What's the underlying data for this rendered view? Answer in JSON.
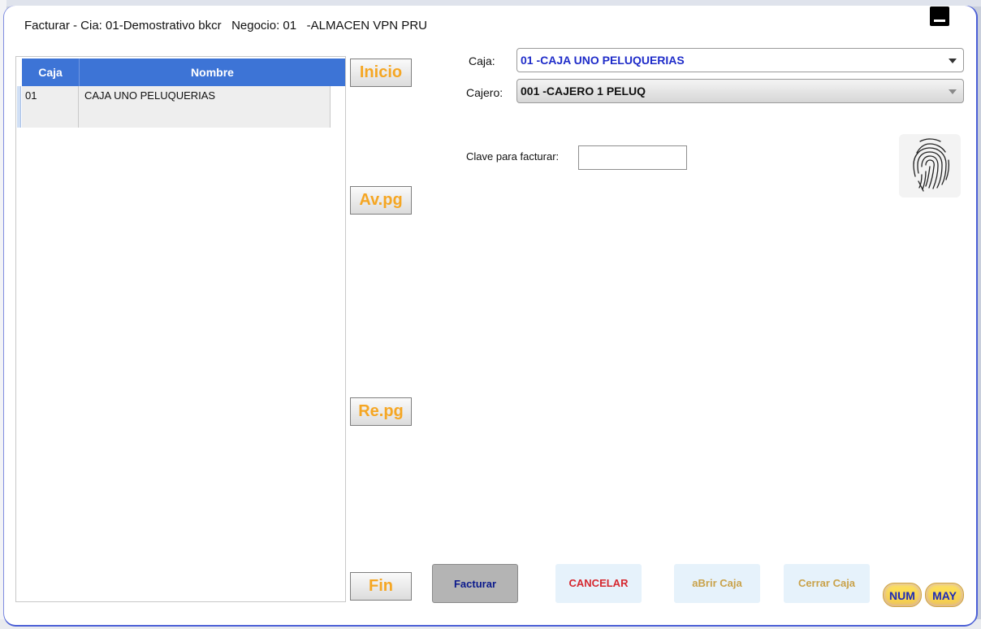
{
  "window": {
    "title": "Facturar - Cia: 01-Demostrativo bkcr   Negocio: 01   -ALMACEN VPN PRU"
  },
  "grid": {
    "columns": [
      "Caja",
      "Nombre"
    ],
    "rows": [
      {
        "caja": "01",
        "nombre": "CAJA UNO PELUQUERIAS"
      }
    ]
  },
  "nav": {
    "inicio": "Inicio",
    "avpg": "Av.pg",
    "repg": "Re.pg",
    "fin": "Fin"
  },
  "form": {
    "caja_label": "Caja:",
    "caja_value": "01   -CAJA UNO PELUQUERIAS",
    "cajero_label": "Cajero:",
    "cajero_value": "001  -CAJERO 1 PELUQ",
    "clave_label": "Clave para facturar:",
    "clave_value": "",
    "fingerprint_icon": "fingerprint-icon"
  },
  "actions": {
    "facturar": "Facturar",
    "cancelar": "CANCELAR",
    "abrir_caja": "aBrir Caja",
    "cerrar_caja": "Cerrar Caja"
  },
  "indicators": {
    "num": "NUM",
    "may": "MAY"
  },
  "colors": {
    "header_blue": "#3d74d6",
    "nav_orange": "#f5a623",
    "combo_blue_text": "#1f2cc9",
    "cancel_red": "#d6282f"
  }
}
